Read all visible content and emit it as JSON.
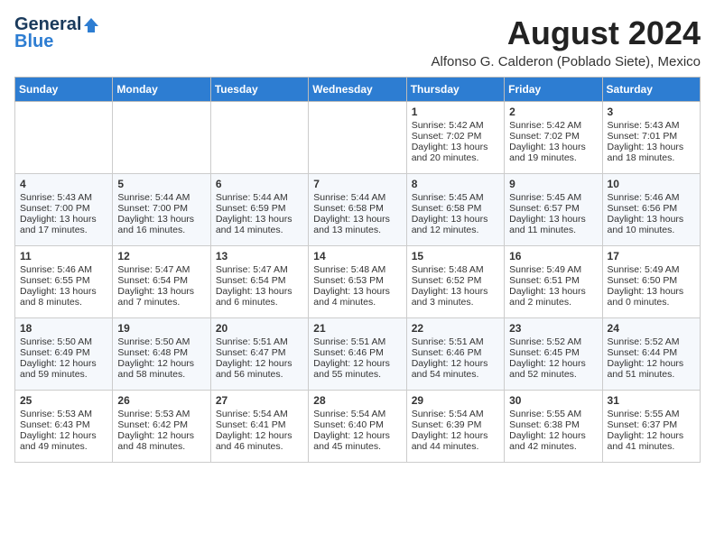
{
  "header": {
    "logo_line1": "General",
    "logo_line2": "Blue",
    "main_title": "August 2024",
    "sub_title": "Alfonso G. Calderon (Poblado Siete), Mexico"
  },
  "weekdays": [
    "Sunday",
    "Monday",
    "Tuesday",
    "Wednesday",
    "Thursday",
    "Friday",
    "Saturday"
  ],
  "weeks": [
    [
      {
        "day": "",
        "info": ""
      },
      {
        "day": "",
        "info": ""
      },
      {
        "day": "",
        "info": ""
      },
      {
        "day": "",
        "info": ""
      },
      {
        "day": "1",
        "info": "Sunrise: 5:42 AM\nSunset: 7:02 PM\nDaylight: 13 hours\nand 20 minutes."
      },
      {
        "day": "2",
        "info": "Sunrise: 5:42 AM\nSunset: 7:02 PM\nDaylight: 13 hours\nand 19 minutes."
      },
      {
        "day": "3",
        "info": "Sunrise: 5:43 AM\nSunset: 7:01 PM\nDaylight: 13 hours\nand 18 minutes."
      }
    ],
    [
      {
        "day": "4",
        "info": "Sunrise: 5:43 AM\nSunset: 7:00 PM\nDaylight: 13 hours\nand 17 minutes."
      },
      {
        "day": "5",
        "info": "Sunrise: 5:44 AM\nSunset: 7:00 PM\nDaylight: 13 hours\nand 16 minutes."
      },
      {
        "day": "6",
        "info": "Sunrise: 5:44 AM\nSunset: 6:59 PM\nDaylight: 13 hours\nand 14 minutes."
      },
      {
        "day": "7",
        "info": "Sunrise: 5:44 AM\nSunset: 6:58 PM\nDaylight: 13 hours\nand 13 minutes."
      },
      {
        "day": "8",
        "info": "Sunrise: 5:45 AM\nSunset: 6:58 PM\nDaylight: 13 hours\nand 12 minutes."
      },
      {
        "day": "9",
        "info": "Sunrise: 5:45 AM\nSunset: 6:57 PM\nDaylight: 13 hours\nand 11 minutes."
      },
      {
        "day": "10",
        "info": "Sunrise: 5:46 AM\nSunset: 6:56 PM\nDaylight: 13 hours\nand 10 minutes."
      }
    ],
    [
      {
        "day": "11",
        "info": "Sunrise: 5:46 AM\nSunset: 6:55 PM\nDaylight: 13 hours\nand 8 minutes."
      },
      {
        "day": "12",
        "info": "Sunrise: 5:47 AM\nSunset: 6:54 PM\nDaylight: 13 hours\nand 7 minutes."
      },
      {
        "day": "13",
        "info": "Sunrise: 5:47 AM\nSunset: 6:54 PM\nDaylight: 13 hours\nand 6 minutes."
      },
      {
        "day": "14",
        "info": "Sunrise: 5:48 AM\nSunset: 6:53 PM\nDaylight: 13 hours\nand 4 minutes."
      },
      {
        "day": "15",
        "info": "Sunrise: 5:48 AM\nSunset: 6:52 PM\nDaylight: 13 hours\nand 3 minutes."
      },
      {
        "day": "16",
        "info": "Sunrise: 5:49 AM\nSunset: 6:51 PM\nDaylight: 13 hours\nand 2 minutes."
      },
      {
        "day": "17",
        "info": "Sunrise: 5:49 AM\nSunset: 6:50 PM\nDaylight: 13 hours\nand 0 minutes."
      }
    ],
    [
      {
        "day": "18",
        "info": "Sunrise: 5:50 AM\nSunset: 6:49 PM\nDaylight: 12 hours\nand 59 minutes."
      },
      {
        "day": "19",
        "info": "Sunrise: 5:50 AM\nSunset: 6:48 PM\nDaylight: 12 hours\nand 58 minutes."
      },
      {
        "day": "20",
        "info": "Sunrise: 5:51 AM\nSunset: 6:47 PM\nDaylight: 12 hours\nand 56 minutes."
      },
      {
        "day": "21",
        "info": "Sunrise: 5:51 AM\nSunset: 6:46 PM\nDaylight: 12 hours\nand 55 minutes."
      },
      {
        "day": "22",
        "info": "Sunrise: 5:51 AM\nSunset: 6:46 PM\nDaylight: 12 hours\nand 54 minutes."
      },
      {
        "day": "23",
        "info": "Sunrise: 5:52 AM\nSunset: 6:45 PM\nDaylight: 12 hours\nand 52 minutes."
      },
      {
        "day": "24",
        "info": "Sunrise: 5:52 AM\nSunset: 6:44 PM\nDaylight: 12 hours\nand 51 minutes."
      }
    ],
    [
      {
        "day": "25",
        "info": "Sunrise: 5:53 AM\nSunset: 6:43 PM\nDaylight: 12 hours\nand 49 minutes."
      },
      {
        "day": "26",
        "info": "Sunrise: 5:53 AM\nSunset: 6:42 PM\nDaylight: 12 hours\nand 48 minutes."
      },
      {
        "day": "27",
        "info": "Sunrise: 5:54 AM\nSunset: 6:41 PM\nDaylight: 12 hours\nand 46 minutes."
      },
      {
        "day": "28",
        "info": "Sunrise: 5:54 AM\nSunset: 6:40 PM\nDaylight: 12 hours\nand 45 minutes."
      },
      {
        "day": "29",
        "info": "Sunrise: 5:54 AM\nSunset: 6:39 PM\nDaylight: 12 hours\nand 44 minutes."
      },
      {
        "day": "30",
        "info": "Sunrise: 5:55 AM\nSunset: 6:38 PM\nDaylight: 12 hours\nand 42 minutes."
      },
      {
        "day": "31",
        "info": "Sunrise: 5:55 AM\nSunset: 6:37 PM\nDaylight: 12 hours\nand 41 minutes."
      }
    ]
  ]
}
